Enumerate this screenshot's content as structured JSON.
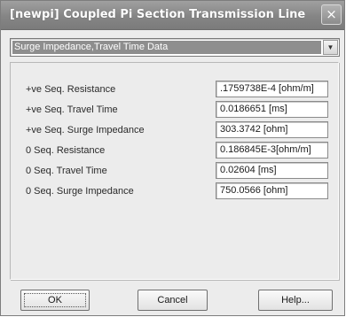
{
  "window": {
    "title": "[newpi] Coupled Pi Section Transmission Line",
    "close_glyph": "×"
  },
  "dropdown": {
    "selected": "Surge Impedance,Travel Time Data",
    "arrow_glyph": "▼"
  },
  "rows": [
    {
      "label": "+ve Seq. Resistance",
      "value": ".1759738E-4 [ohm/m]"
    },
    {
      "label": "+ve Seq. Travel Time",
      "value": "0.0186651 [ms]"
    },
    {
      "label": "+ve Seq. Surge Impedance",
      "value": "303.3742 [ohm]"
    },
    {
      "label": "0 Seq. Resistance",
      "value": "0.186845E-3[ohm/m]"
    },
    {
      "label": "0 Seq. Travel Time",
      "value": "0.02604 [ms]"
    },
    {
      "label": "0 Seq. Surge Impedance",
      "value": "750.0566 [ohm]"
    }
  ],
  "buttons": {
    "ok": "OK",
    "cancel": "Cancel",
    "help": "Help..."
  }
}
